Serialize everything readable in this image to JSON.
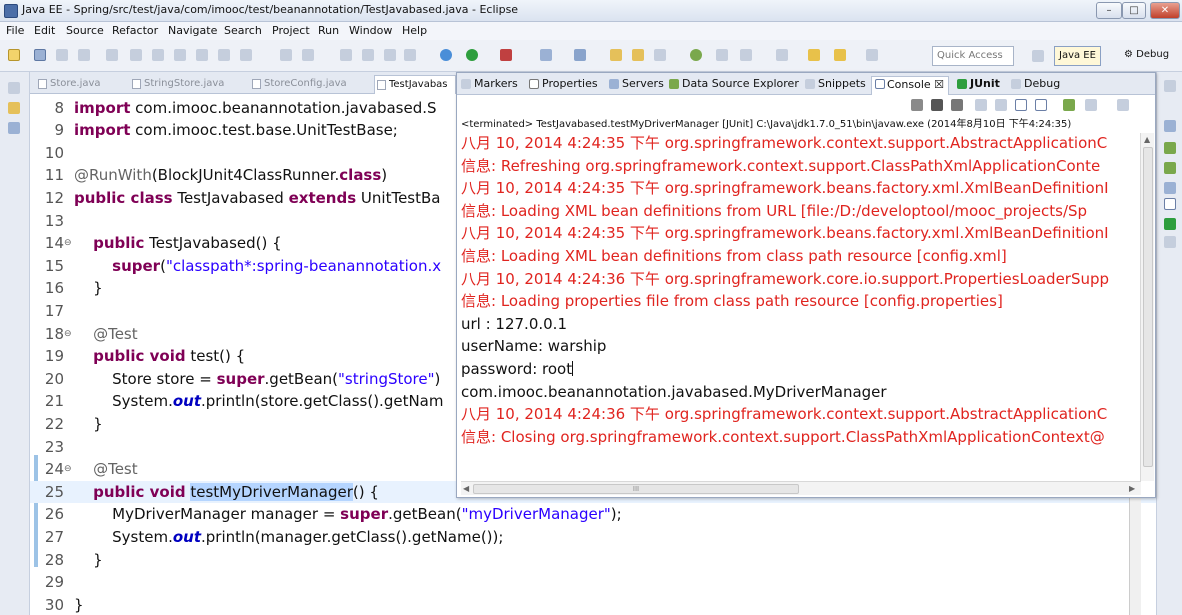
{
  "window": {
    "title": "Java EE - Spring/src/test/java/com/imooc/test/beanannotation/TestJavabased.java - Eclipse",
    "controls": [
      "–",
      "□",
      "✕"
    ]
  },
  "menu": [
    "File",
    "Edit",
    "Source",
    "Refactor",
    "Navigate",
    "Search",
    "Project",
    "Run",
    "Window",
    "Help"
  ],
  "toolbar": {
    "quick_access": "Quick Access",
    "perspectives": [
      "Java EE",
      "Debug"
    ]
  },
  "editor": {
    "tabs": [
      "Store.java",
      "StringStore.java",
      "StoreConfig.java",
      "TestJavabas"
    ],
    "lines": [
      {
        "n": "8",
        "fold": "",
        "code": [
          {
            "t": "import",
            "c": "kw"
          },
          {
            "t": " com.imooc.beanannotation.javabased.S"
          }
        ]
      },
      {
        "n": "9",
        "fold": "",
        "code": [
          {
            "t": "import",
            "c": "kw"
          },
          {
            "t": " com.imooc.test.base.UnitTestBase;"
          }
        ]
      },
      {
        "n": "10",
        "fold": "",
        "code": []
      },
      {
        "n": "11",
        "fold": "",
        "code": [
          {
            "t": "@RunWith",
            "c": "ann"
          },
          {
            "t": "(BlockJUnit4ClassRunner."
          },
          {
            "t": "class",
            "c": "kw"
          },
          {
            "t": ")"
          }
        ]
      },
      {
        "n": "12",
        "fold": "",
        "code": [
          {
            "t": "public class",
            "c": "kw"
          },
          {
            "t": " TestJavabased "
          },
          {
            "t": "extends",
            "c": "kw"
          },
          {
            "t": " UnitTestBa"
          }
        ]
      },
      {
        "n": "13",
        "fold": "",
        "code": []
      },
      {
        "n": "14",
        "fold": "⊖",
        "code": [
          {
            "t": "    "
          },
          {
            "t": "public",
            "c": "kw"
          },
          {
            "t": " TestJavabased() {"
          }
        ]
      },
      {
        "n": "15",
        "fold": "",
        "code": [
          {
            "t": "        "
          },
          {
            "t": "super",
            "c": "kw"
          },
          {
            "t": "("
          },
          {
            "t": "\"classpath*:spring-beanannotation.x",
            "c": "str"
          }
        ]
      },
      {
        "n": "16",
        "fold": "",
        "code": [
          {
            "t": "    }"
          }
        ]
      },
      {
        "n": "17",
        "fold": "",
        "code": []
      },
      {
        "n": "18",
        "fold": "⊖",
        "code": [
          {
            "t": "    "
          },
          {
            "t": "@Test",
            "c": "ann"
          }
        ]
      },
      {
        "n": "19",
        "fold": "",
        "code": [
          {
            "t": "    "
          },
          {
            "t": "public void",
            "c": "kw"
          },
          {
            "t": " test() {"
          }
        ]
      },
      {
        "n": "20",
        "fold": "",
        "code": [
          {
            "t": "        Store store = "
          },
          {
            "t": "super",
            "c": "kw"
          },
          {
            "t": ".getBean("
          },
          {
            "t": "\"stringStore\"",
            "c": "str"
          },
          {
            "t": ")"
          }
        ]
      },
      {
        "n": "21",
        "fold": "",
        "code": [
          {
            "t": "        System."
          },
          {
            "t": "out",
            "c": "fld"
          },
          {
            "t": ".println(store.getClass().getNam"
          }
        ]
      },
      {
        "n": "22",
        "fold": "",
        "code": [
          {
            "t": "    }"
          }
        ]
      },
      {
        "n": "23",
        "fold": "",
        "code": []
      },
      {
        "n": "24",
        "fold": "⊖",
        "code": [
          {
            "t": "    "
          },
          {
            "t": "@Test",
            "c": "ann"
          }
        ]
      },
      {
        "n": "25",
        "fold": "",
        "code": [
          {
            "t": "    "
          },
          {
            "t": "public void",
            "c": "kw"
          },
          {
            "t": " "
          },
          {
            "t": "testMyDriverManager",
            "c": "hl-sel"
          },
          {
            "t": "() {"
          }
        ]
      },
      {
        "n": "26",
        "fold": "",
        "code": [
          {
            "t": "        MyDriverManager manager = "
          },
          {
            "t": "super",
            "c": "kw"
          },
          {
            "t": ".getBean("
          },
          {
            "t": "\"myDriverManager\"",
            "c": "str"
          },
          {
            "t": ");"
          }
        ]
      },
      {
        "n": "27",
        "fold": "",
        "code": [
          {
            "t": "        System."
          },
          {
            "t": "out",
            "c": "fld"
          },
          {
            "t": ".println(manager.getClass().getName());"
          }
        ]
      },
      {
        "n": "28",
        "fold": "",
        "code": [
          {
            "t": "    }"
          }
        ]
      },
      {
        "n": "29",
        "fold": "",
        "code": []
      },
      {
        "n": "30",
        "fold": "",
        "code": [
          {
            "t": "}"
          }
        ]
      }
    ]
  },
  "console": {
    "tabs": [
      "Markers",
      "Properties",
      "Servers",
      "Data Source Explorer",
      "Snippets",
      "Console ☒",
      "JUnit",
      "Debug"
    ],
    "status": "<terminated> TestJavabased.testMyDriverManager [JUnit] C:\\Java\\jdk1.7.0_51\\bin\\javaw.exe (2014年8月10日 下午4:24:35)",
    "lines": [
      {
        "type": "err",
        "text": "八月 10, 2014 4:24:35 下午 org.springframework.context.support.AbstractApplicationC"
      },
      {
        "type": "err",
        "text": "信息: Refreshing org.springframework.context.support.ClassPathXmlApplicationConte"
      },
      {
        "type": "err",
        "text": "八月 10, 2014 4:24:35 下午 org.springframework.beans.factory.xml.XmlBeanDefinitionI"
      },
      {
        "type": "err",
        "text": "信息: Loading XML bean definitions from URL [file:/D:/developtool/mooc_projects/Sp"
      },
      {
        "type": "err",
        "text": "八月 10, 2014 4:24:35 下午 org.springframework.beans.factory.xml.XmlBeanDefinitionI"
      },
      {
        "type": "err",
        "text": "信息: Loading XML bean definitions from class path resource [config.xml]"
      },
      {
        "type": "err",
        "text": "八月 10, 2014 4:24:36 下午 org.springframework.core.io.support.PropertiesLoaderSupp"
      },
      {
        "type": "err",
        "text": "信息: Loading properties file from class path resource [config.properties]"
      },
      {
        "type": "out",
        "text": "url : 127.0.0.1"
      },
      {
        "type": "out",
        "text": "userName: warship"
      },
      {
        "type": "out",
        "text": "password: root"
      },
      {
        "type": "out",
        "text": "com.imooc.beanannotation.javabased.MyDriverManager"
      },
      {
        "type": "err",
        "text": "八月 10, 2014 4:24:36 下午 org.springframework.context.support.AbstractApplicationC"
      },
      {
        "type": "err",
        "text": "信息: Closing org.springframework.context.support.ClassPathXmlApplicationContext@"
      }
    ],
    "hscroll_grip": "III"
  },
  "colors": {
    "keyword": "#7f0055",
    "string": "#2a00ff",
    "annotation": "#646464",
    "console_error": "#e0241f",
    "selection": "#b5d5ff"
  }
}
